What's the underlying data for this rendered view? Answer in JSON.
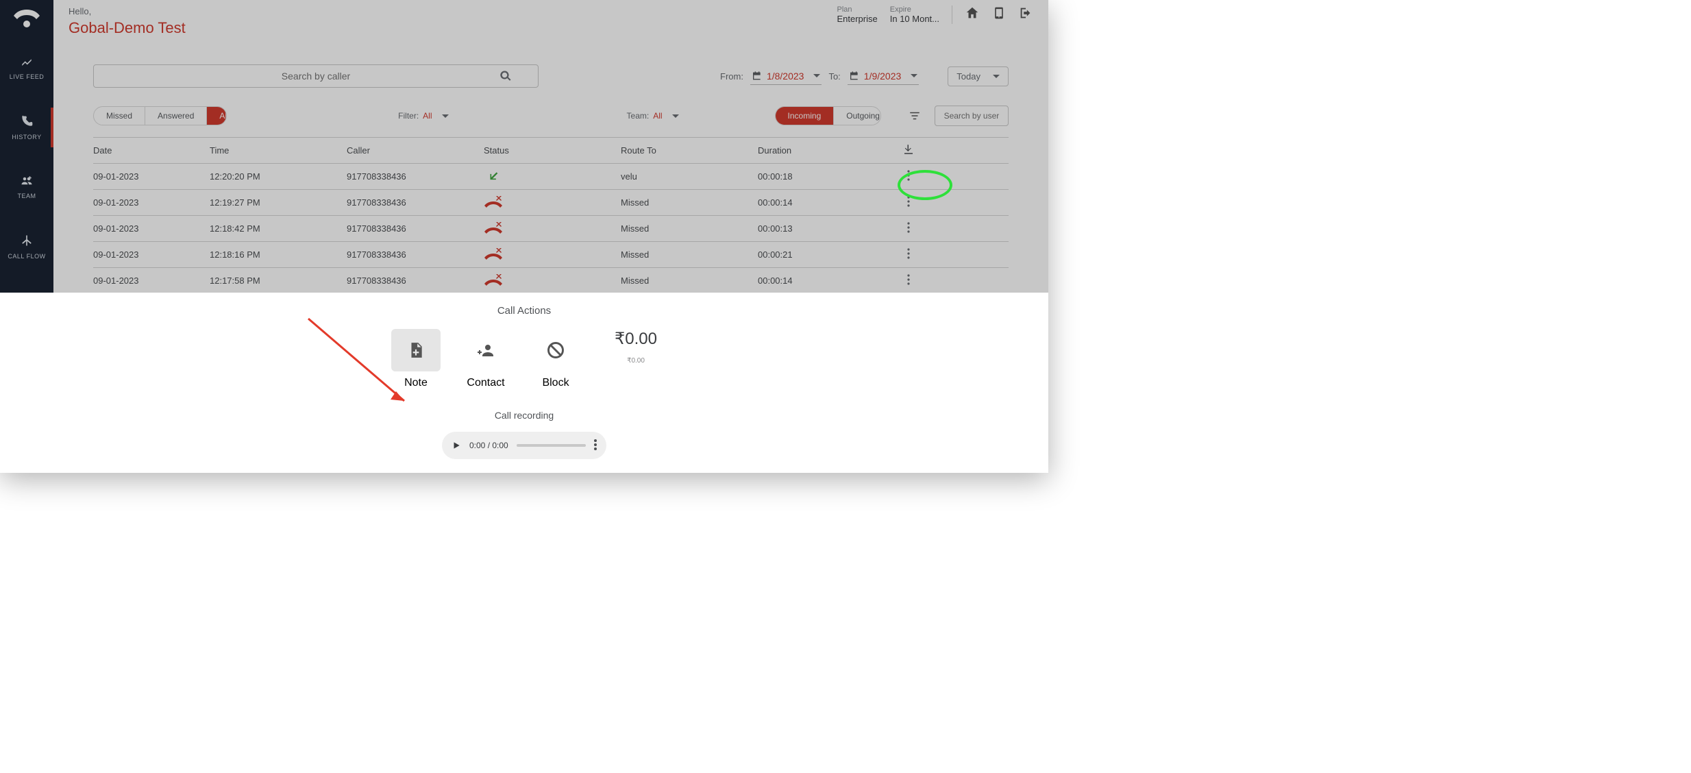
{
  "header": {
    "hello": "Hello,",
    "username": "Gobal-Demo Test",
    "plan_label": "Plan",
    "plan_value": "Enterprise",
    "expire_label": "Expire",
    "expire_value": "In 10 Mont..."
  },
  "sidebar": {
    "items": [
      {
        "label": "LIVE FEED"
      },
      {
        "label": "HISTORY"
      },
      {
        "label": "TEAM"
      },
      {
        "label": "CALL FLOW"
      }
    ]
  },
  "search": {
    "placeholder": "Search by caller"
  },
  "dates": {
    "from_label": "From:",
    "from_value": "1/8/2023",
    "to_label": "To:",
    "to_value": "1/9/2023",
    "preset": "Today"
  },
  "filters": {
    "missed": "Missed",
    "answered": "Answered",
    "all": "All",
    "filter_label": "Filter:",
    "filter_value": "All",
    "team_label": "Team:",
    "team_value": "All",
    "incoming": "Incoming",
    "outgoing": "Outgoing",
    "search_user_placeholder": "Search by user"
  },
  "columns": {
    "date": "Date",
    "time": "Time",
    "caller": "Caller",
    "status": "Status",
    "route": "Route To",
    "duration": "Duration"
  },
  "rows": [
    {
      "date": "09-01-2023",
      "time": "12:20:20 PM",
      "caller": "917708338436",
      "status": "incoming",
      "route": "velu",
      "dur": "00:00:18"
    },
    {
      "date": "09-01-2023",
      "time": "12:19:27 PM",
      "caller": "917708338436",
      "status": "missed",
      "route": "Missed",
      "dur": "00:00:14"
    },
    {
      "date": "09-01-2023",
      "time": "12:18:42 PM",
      "caller": "917708338436",
      "status": "missed",
      "route": "Missed",
      "dur": "00:00:13"
    },
    {
      "date": "09-01-2023",
      "time": "12:18:16 PM",
      "caller": "917708338436",
      "status": "missed",
      "route": "Missed",
      "dur": "00:00:21"
    },
    {
      "date": "09-01-2023",
      "time": "12:17:58 PM",
      "caller": "917708338436",
      "status": "missed",
      "route": "Missed",
      "dur": "00:00:14"
    }
  ],
  "panel": {
    "title": "Call Actions",
    "note": "Note",
    "contact": "Contact",
    "block": "Block",
    "price_big": "₹0.00",
    "price_small": "₹0.00",
    "rec_title": "Call recording",
    "audio_time": "0:00 / 0:00"
  }
}
